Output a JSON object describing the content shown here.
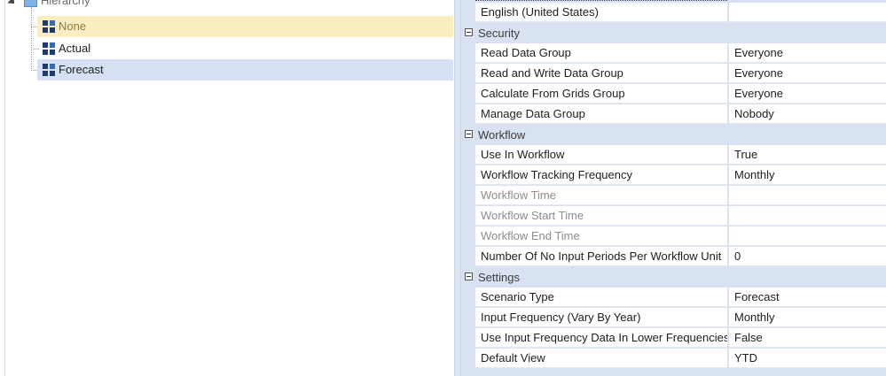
{
  "tree": {
    "root_label": "Hierarchy",
    "items": [
      {
        "label": "None",
        "state": "hover"
      },
      {
        "label": "Actual",
        "state": "normal"
      },
      {
        "label": "Forecast",
        "state": "selected"
      }
    ]
  },
  "grid": {
    "top_row": {
      "name": "English (United States)",
      "value": ""
    },
    "categories": [
      {
        "title": "Security",
        "rows": [
          {
            "name": "Read Data Group",
            "value": "Everyone",
            "disabled": false
          },
          {
            "name": "Read and Write Data Group",
            "value": "Everyone",
            "disabled": false
          },
          {
            "name": "Calculate From Grids Group",
            "value": "Everyone",
            "disabled": false
          },
          {
            "name": "Manage Data Group",
            "value": "Nobody",
            "disabled": false
          }
        ]
      },
      {
        "title": "Workflow",
        "rows": [
          {
            "name": "Use In Workflow",
            "value": "True",
            "disabled": false
          },
          {
            "name": "Workflow Tracking Frequency",
            "value": "Monthly",
            "disabled": false
          },
          {
            "name": "Workflow Time",
            "value": "",
            "disabled": true
          },
          {
            "name": "Workflow Start Time",
            "value": "",
            "disabled": true
          },
          {
            "name": "Workflow End Time",
            "value": "",
            "disabled": true
          },
          {
            "name": "Number Of No Input Periods Per Workflow Unit",
            "value": "0",
            "disabled": false
          }
        ]
      },
      {
        "title": "Settings",
        "rows": [
          {
            "name": "Scenario Type",
            "value": "Forecast",
            "disabled": false
          },
          {
            "name": "Input Frequency (Vary By Year)",
            "value": "Monthly",
            "disabled": false
          },
          {
            "name": "Use Input Frequency Data In Lower Frequencies",
            "value": "False",
            "disabled": false
          },
          {
            "name": "Default View",
            "value": "YTD",
            "disabled": false
          }
        ]
      }
    ]
  },
  "colors": {
    "hover_row": "#fbefc1",
    "selected_row": "#d5e1f3",
    "category_band": "#d8e2f2",
    "folder": "#4a90d9",
    "cube": "#1e3a6e"
  },
  "icons": {
    "expander": "expanded-triangle-icon",
    "folder": "folder-icon",
    "member": "cube-member-icon",
    "category_toggle": "collapse-minus-icon"
  }
}
